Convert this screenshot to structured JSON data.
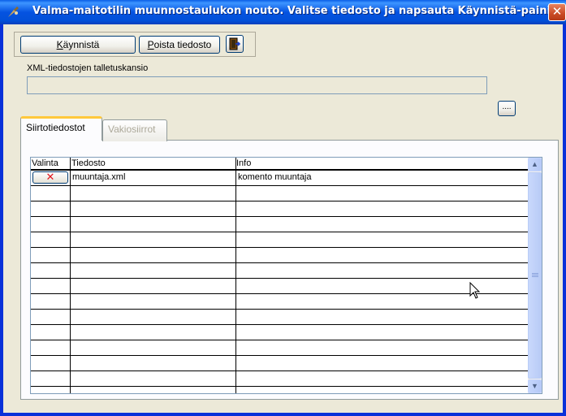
{
  "window": {
    "title": "Valma-maitotilin muunnostaulukon nouto. Valitse tiedosto ja napsauta Käynnistä-painiketta.",
    "close_label": "✕"
  },
  "toolbar": {
    "start_label_underline": "K",
    "start_label_rest": "äynnistä",
    "delete_label_underline": "P",
    "delete_label_rest": "oista tiedosto"
  },
  "folder": {
    "label": "XML-tiedostojen talletuskansio",
    "value": "",
    "browse_label": "...."
  },
  "tabs": [
    {
      "label": "Siirtotiedostot",
      "active": true
    },
    {
      "label": "Vakiosiirrot",
      "active": false
    }
  ],
  "grid": {
    "columns": [
      "Valinta",
      "Tiedosto",
      "Info"
    ],
    "rows": [
      {
        "selected": true,
        "file": "muuntaja.xml",
        "info": "komento muuntaja"
      },
      {
        "file": "",
        "info": ""
      },
      {
        "file": "",
        "info": ""
      },
      {
        "file": "",
        "info": ""
      },
      {
        "file": "",
        "info": ""
      },
      {
        "file": "",
        "info": ""
      },
      {
        "file": "",
        "info": ""
      },
      {
        "file": "",
        "info": ""
      },
      {
        "file": "",
        "info": ""
      },
      {
        "file": "",
        "info": ""
      },
      {
        "file": "",
        "info": ""
      },
      {
        "file": "",
        "info": ""
      },
      {
        "file": "",
        "info": ""
      },
      {
        "file": "",
        "info": ""
      }
    ],
    "check_mark": "✕"
  },
  "colors": {
    "titlebar": "#0553e1",
    "window_bg": "#ece9d8",
    "check_mark": "#e0141e"
  }
}
